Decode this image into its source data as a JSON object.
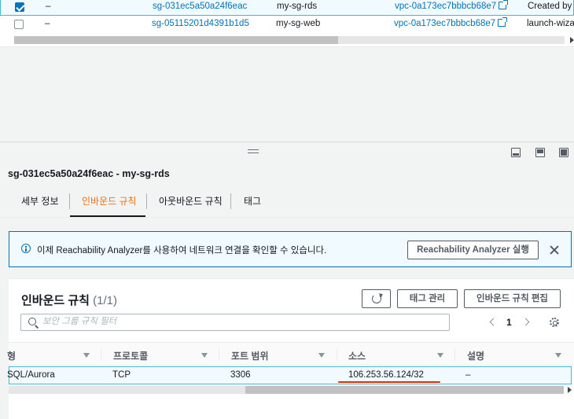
{
  "top_table": {
    "rows": [
      {
        "selected": true,
        "name": "–",
        "sg_id": "sg-031ec5a50a24f6eac",
        "sg_name": "my-sg-rds",
        "vpc": "vpc-0a173ec7bbbcb68e7",
        "desc": "Created by R"
      },
      {
        "selected": false,
        "name": "–",
        "sg_id": "sg-05115201d4391b1d5",
        "sg_name": "my-sg-web",
        "vpc": "vpc-0a173ec7bbbcb68e7",
        "desc": "launch-wizar"
      }
    ]
  },
  "detail": {
    "title": "sg-031ec5a50a24f6eac - my-sg-rds",
    "tabs": [
      "세부 정보",
      "인바운드 규칙",
      "아웃바운드 규칙",
      "태그"
    ],
    "active_tab": 1
  },
  "banner": {
    "text": "이제 Reachability Analyzer를 사용하여 네트워크 연결을 확인할 수 있습니다.",
    "button": "Reachability Analyzer 실행"
  },
  "rules": {
    "title": "인바운드 규칙",
    "count": "(1/1)",
    "manage_tags": "태그 관리",
    "edit_rules": "인바운드 규칙 편집",
    "filter_placeholder": "보안 그룹 규칙 필터",
    "page": "1",
    "columns": [
      "형",
      "프로토콜",
      "포트 범위",
      "소스",
      "설명"
    ],
    "row": {
      "type": "SQL/Aurora",
      "protocol": "TCP",
      "port": "3306",
      "source": "106.253.56.124/32",
      "desc": "–"
    }
  },
  "colors": {
    "accent_tab": "#ec7211",
    "link": "#0073bb",
    "selection_border": "#44b9d6",
    "highlight": "#d13212"
  }
}
